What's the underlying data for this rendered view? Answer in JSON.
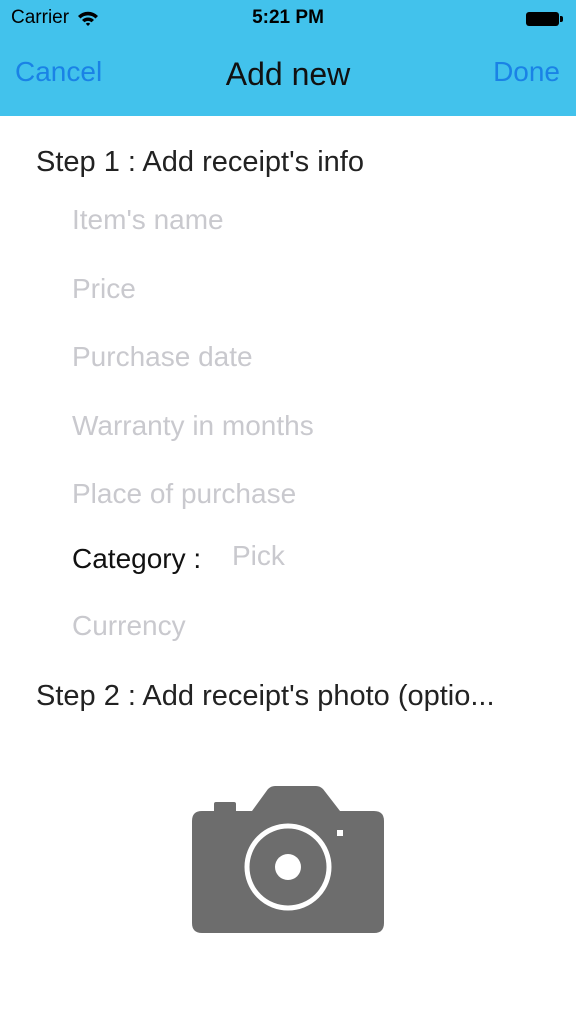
{
  "status_bar": {
    "carrier": "Carrier",
    "time": "5:21 PM"
  },
  "nav": {
    "cancel": "Cancel",
    "title": "Add new",
    "done": "Done"
  },
  "step1": {
    "title": "Step 1 : Add receipt's info",
    "fields": {
      "item_name": "Item's name",
      "price": "Price",
      "purchase_date": "Purchase date",
      "warranty": "Warranty in months",
      "place": "Place of purchase",
      "currency": "Currency"
    },
    "category_label": "Category :",
    "category_value": "Pick"
  },
  "step2": {
    "title": "Step 2 : Add receipt's photo (optio..."
  },
  "colors": {
    "nav_bar": "#42c2ec",
    "nav_button": "#1a82e6",
    "placeholder": "#c9c9ce",
    "camera_icon": "#6d6d6d"
  },
  "icons": {
    "wifi": "wifi-icon",
    "battery": "battery-icon",
    "camera": "camera-icon"
  }
}
